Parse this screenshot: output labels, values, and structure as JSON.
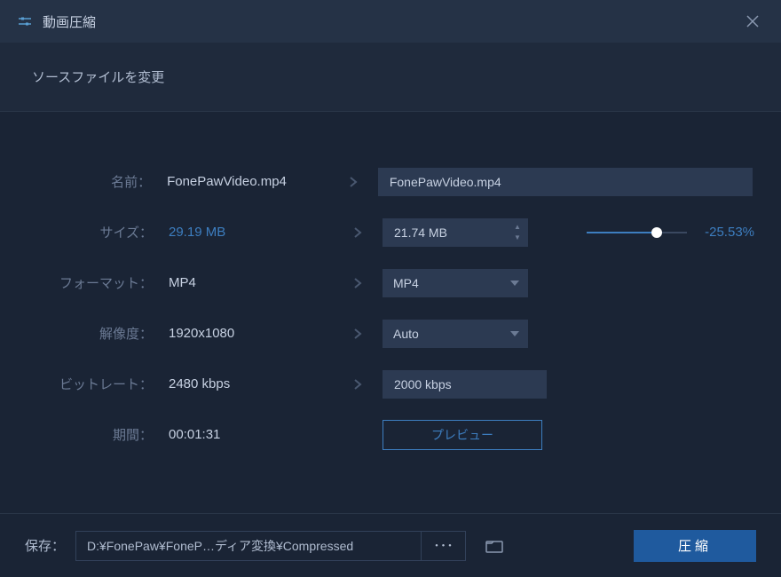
{
  "titlebar": {
    "title": "動画圧縮"
  },
  "subtitle": "ソースファイルを変更",
  "labels": {
    "name": "名前：",
    "size": "サイズ：",
    "format": "フォーマット：",
    "resolution": "解像度：",
    "bitrate": "ビットレート：",
    "duration": "期間："
  },
  "source": {
    "name": "FonePawVideo.mp4",
    "size": "29.19 MB",
    "format": "MP4",
    "resolution": "1920x1080",
    "bitrate": "2480 kbps",
    "duration": "00:01:31"
  },
  "target": {
    "name": "FonePawVideo.mp4",
    "size": "21.74 MB",
    "format": "MP4",
    "resolution": "Auto",
    "bitrate": "2000 kbps"
  },
  "compression": {
    "slider_fill_pct": 70,
    "pct_label": "-25.53%"
  },
  "buttons": {
    "preview": "プレビュー",
    "compress": "圧縮"
  },
  "footer": {
    "save_label": "保存：",
    "save_path": "D:¥FonePaw¥FoneP…ディア変換¥Compressed",
    "more": "･･･"
  }
}
